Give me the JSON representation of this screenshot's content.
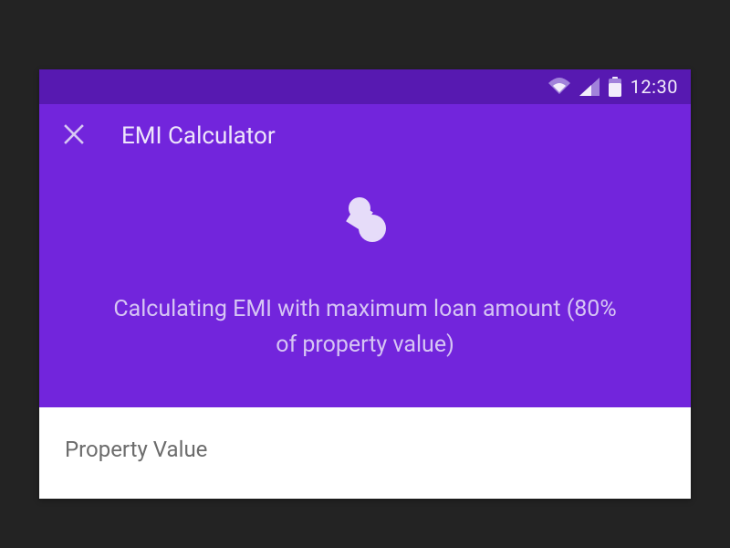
{
  "status_bar": {
    "time": "12:30"
  },
  "app_bar": {
    "title": "EMI Calculator"
  },
  "hero": {
    "message": "Calculating EMI with maximum loan amount (80% of property value)"
  },
  "form": {
    "property_value_label": "Property Value"
  }
}
